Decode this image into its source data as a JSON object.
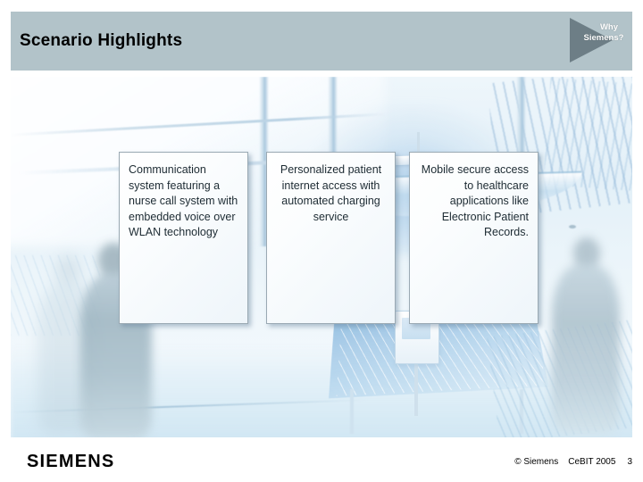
{
  "header": {
    "title": "Scenario Highlights",
    "band_color": "#b2c3c9"
  },
  "badge": {
    "name": "why-siemens-badge",
    "line1": "Why",
    "line2": "Siemens?",
    "triangle_color": "#6d7e86",
    "text_color": "#ffffff"
  },
  "boxes": [
    {
      "id": "content-box-1",
      "align": "left",
      "text": "Communication system featuring a nurse call system with embedded voice over WLAN technology"
    },
    {
      "id": "content-box-2",
      "align": "center",
      "text": "Personalized patient internet access with automated charging service"
    },
    {
      "id": "content-box-3",
      "align": "right",
      "text": "Mobile secure access to healthcare applications like Electronic Patient Records."
    }
  ],
  "footer": {
    "logo": "SIEMENS",
    "copyright": "© Siemens",
    "event": "CeBIT 2005",
    "page_number": "3"
  },
  "photo": {
    "description": "blurred light-blue modern atrium interior with glass canopy and walking people silhouettes"
  }
}
